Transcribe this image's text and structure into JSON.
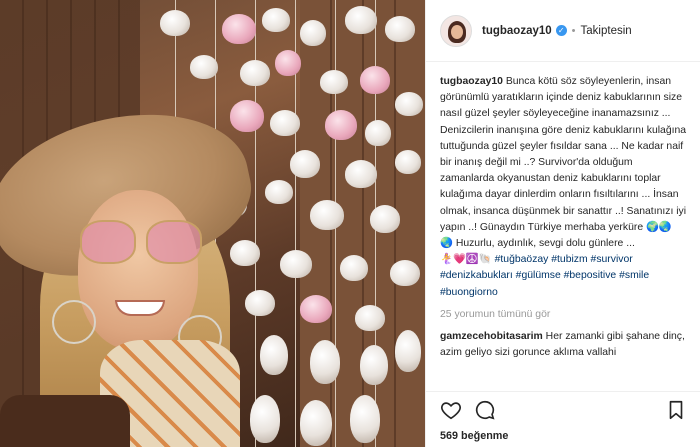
{
  "post": {
    "username": "tugbaozay10",
    "verified_mark": "✓",
    "separator": "•",
    "follow_status": "Takiptesin",
    "caption_user": "tugbaozay10",
    "caption_text": " Bunca kötü söz söyleyenlerin, insan görünümlü yaratıkların içinde deniz kabuklarının size nasıl güzel şeyler söyleyeceğine inanamazsınız ... Denizcilerin inanışına göre deniz kabuklarını kulağına tuttuğunda güzel şeyler fısıldar sana ... Ne kadar naif bir inanış değil mi ..? Survivor'da olduğum zamanlarda okyanustan deniz kabuklarını toplar kulağıma dayar dinlerdim onların fısıltılarını ... İnsan olmak, insanca düşünmek bir sanattır ..! Sanatınızı iyi yapın ..! Günaydın Türkiye merhaba yerküre 🌍🌏",
    "caption_line2": "🌏 Huzurlu, aydınlık, sevgi dolu günlere ...",
    "emoji_line": "🧜‍♀️💗☮️🐚 ",
    "hashtags": [
      "#tuğbaözay",
      "#tubizm",
      "#survivor",
      "#denizkabukları",
      "#gülümse",
      "#bepositive",
      "#smile",
      "#buongiorno"
    ],
    "view_comments": "25 yorumun tümünü gör",
    "comment_user": "gamzecehobitasarim",
    "comment_text": " Her zamanki gibi şahane dinç, azim geliyo sizi gorunce aklıma vallahi",
    "likes": "569 beğenme"
  },
  "colors": {
    "accent": "#3897f0",
    "hashtag": "#003569",
    "muted": "#999999"
  }
}
